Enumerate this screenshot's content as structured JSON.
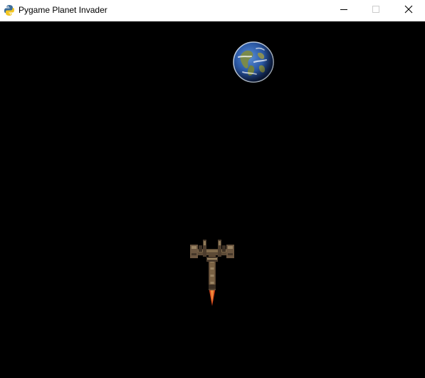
{
  "window": {
    "title": "Pygame Planet Invader",
    "app_icon": "pygame-snake-icon",
    "controls": [
      "minimize-icon",
      "maximize-icon",
      "close-icon"
    ]
  },
  "game": {
    "background_color": "#000000",
    "sprites": [
      {
        "name": "planet",
        "icon": "earth-planet-icon",
        "color": "#2f5fa6"
      },
      {
        "name": "player-ship",
        "icon": "spaceship-icon",
        "color": "#6a4e32",
        "thruster_color": "#d2431a"
      }
    ]
  }
}
